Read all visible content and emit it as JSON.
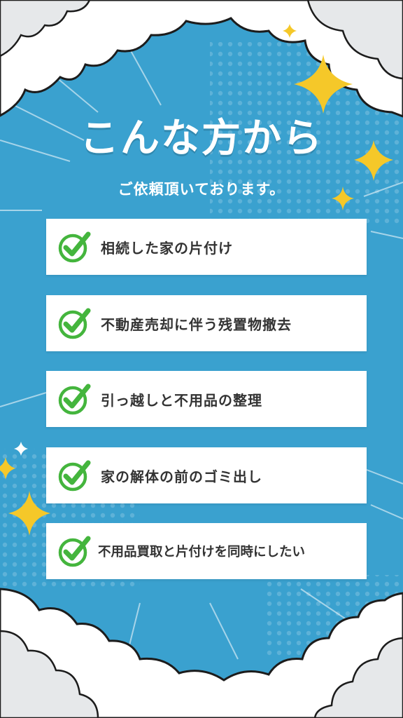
{
  "heading": {
    "title": "こんな方から",
    "subtitle": "ご依頼頂いております。"
  },
  "items": [
    {
      "label": "相続した家の片付け",
      "icon": "check-icon"
    },
    {
      "label": "不動産売却に伴う残置物撤去",
      "icon": "check-icon"
    },
    {
      "label": "引っ越しと不用品の整理",
      "icon": "check-icon"
    },
    {
      "label": "家の解体の前のゴミ出し",
      "icon": "check-icon"
    },
    {
      "label": "不用品買取と片付けを同時にしたい",
      "icon": "check-icon"
    }
  ],
  "colors": {
    "background": "#3aa1cf",
    "check": "#44b53d",
    "sparkle": "#f5c829",
    "cloud": "#ffffff",
    "card": "#ffffff",
    "text": "#333333"
  }
}
